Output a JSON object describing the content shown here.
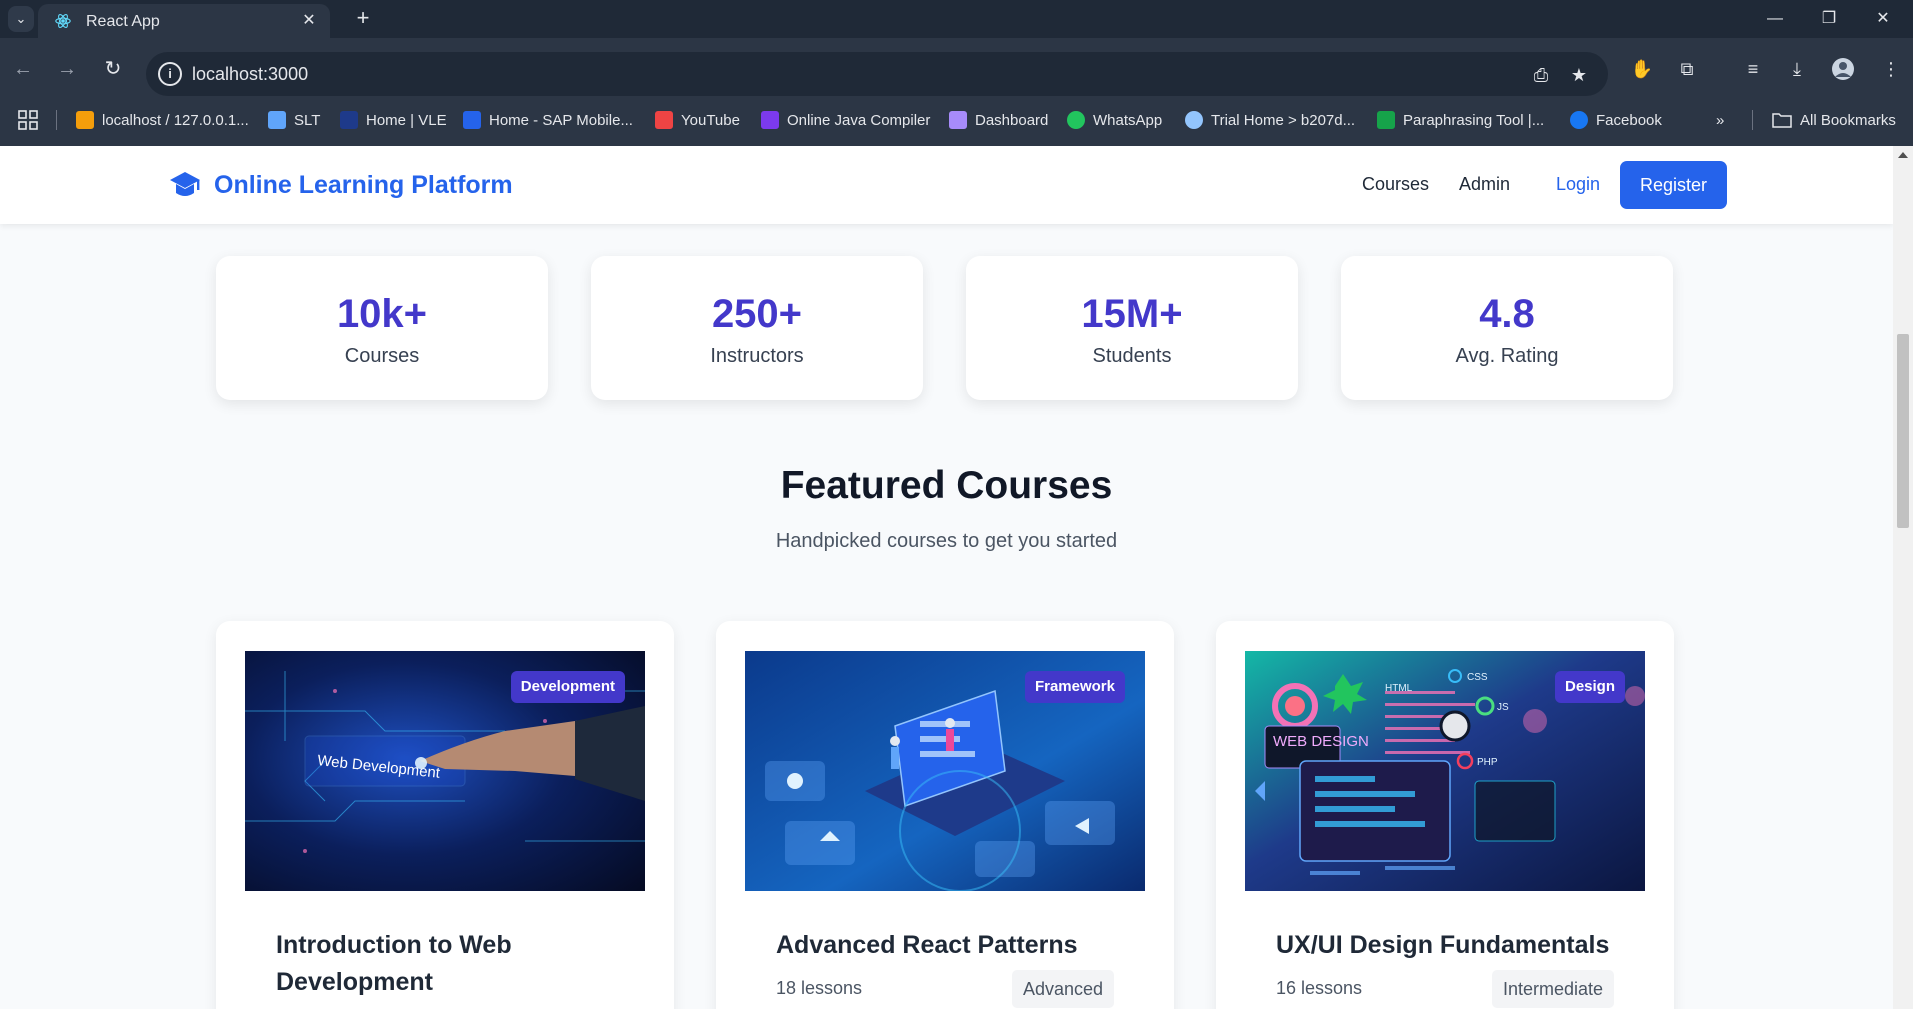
{
  "browser": {
    "tab_title": "React App",
    "url": "localhost:3000",
    "bookmarks": [
      {
        "label": "localhost / 127.0.0.1...",
        "color": "#f59e0b"
      },
      {
        "label": "SLT",
        "color": "#60a5fa"
      },
      {
        "label": "Home | VLE",
        "color": "#1e3a8a"
      },
      {
        "label": "Home - SAP Mobile...",
        "color": "#2563eb"
      },
      {
        "label": "YouTube",
        "color": "#ef4444"
      },
      {
        "label": "Online Java Compiler",
        "color": "#7c3aed"
      },
      {
        "label": "Dashboard",
        "color": "#a78bfa"
      },
      {
        "label": "WhatsApp",
        "color": "#22c55e"
      },
      {
        "label": "Trial Home > b207d...",
        "color": "#93c5fd"
      },
      {
        "label": "Paraphrasing Tool |...",
        "color": "#16a34a"
      },
      {
        "label": "Facebook",
        "color": "#1877f2"
      }
    ],
    "all_bookmarks": "All Bookmarks"
  },
  "header": {
    "brand": "Online Learning Platform",
    "nav": {
      "courses": "Courses",
      "admin": "Admin",
      "login": "Login",
      "register": "Register"
    }
  },
  "stats": [
    {
      "value": "10k+",
      "label": "Courses"
    },
    {
      "value": "250+",
      "label": "Instructors"
    },
    {
      "value": "15M+",
      "label": "Students"
    },
    {
      "value": "4.8",
      "label": "Avg. Rating"
    }
  ],
  "featured": {
    "title": "Featured Courses",
    "subtitle": "Handpicked courses to get you started"
  },
  "courses": [
    {
      "badge": "Development",
      "title": "Introduction to Web Development",
      "lessons": "",
      "level": "",
      "image_text": "Web Development"
    },
    {
      "badge": "Framework",
      "title": "Advanced React Patterns",
      "lessons": "18 lessons",
      "level": "Advanced"
    },
    {
      "badge": "Design",
      "title": "UX/UI Design Fundamentals",
      "lessons": "16 lessons",
      "level": "Intermediate",
      "image_text": "WEB DESIGN",
      "image_labels": {
        "html": "HTML",
        "css": "CSS",
        "js": "JS",
        "php": "PHP"
      }
    }
  ]
}
